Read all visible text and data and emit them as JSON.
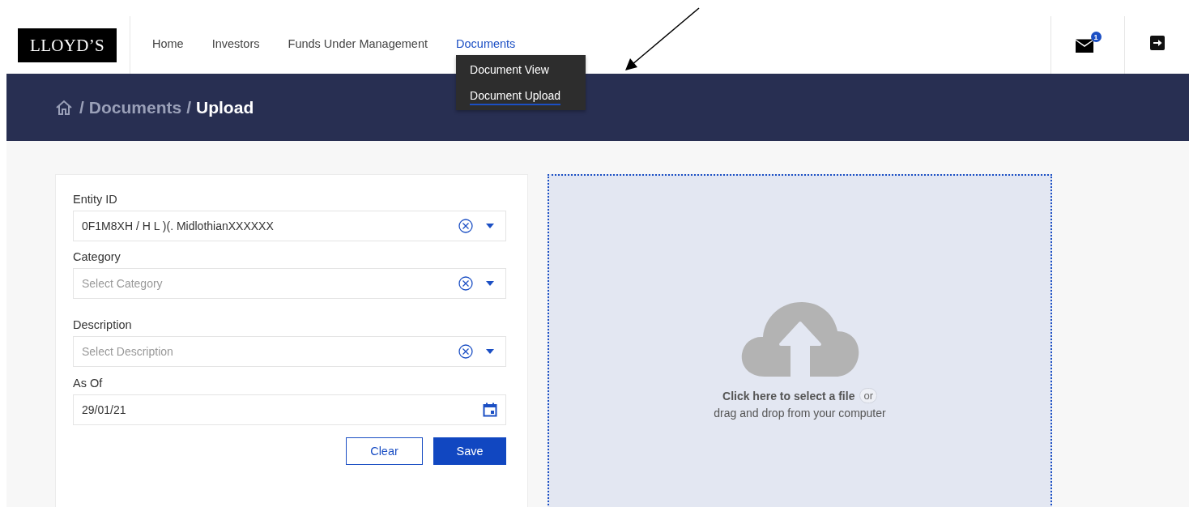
{
  "nav": {
    "logo": "LLOYD’S",
    "items": [
      {
        "label": "Home",
        "selected": false
      },
      {
        "label": "Investors",
        "selected": false
      },
      {
        "label": "Funds Under Management",
        "selected": false
      },
      {
        "label": "Documents",
        "selected": true
      }
    ],
    "menu": [
      {
        "label": "Document View",
        "selected": false
      },
      {
        "label": "Document Upload",
        "selected": true
      }
    ],
    "mail_badge": "1"
  },
  "breadcrumb": [
    {
      "separator": "/",
      "label": "Documents",
      "selected": false
    },
    {
      "separator": "/",
      "label": "Upload",
      "selected": true
    }
  ],
  "form": {
    "fields": [
      {
        "label": "Entity ID",
        "kind": "select",
        "value": "0F1M8XH / H L )(. MidlothianXXXXXX"
      },
      {
        "label": "Category",
        "kind": "select",
        "placeholder": "Select Category"
      },
      {
        "label": "Description",
        "kind": "select",
        "placeholder": "Select Description"
      },
      {
        "label": "As Of",
        "kind": "date",
        "value": "29/01/21"
      }
    ],
    "buttons": [
      {
        "label": "Clear",
        "kind": "secondary"
      },
      {
        "label": "Save",
        "kind": "primary"
      }
    ]
  },
  "dropzone": {
    "link_text": "Click here to select a file",
    "or": "or",
    "hint": "drag and drop from your computer"
  }
}
